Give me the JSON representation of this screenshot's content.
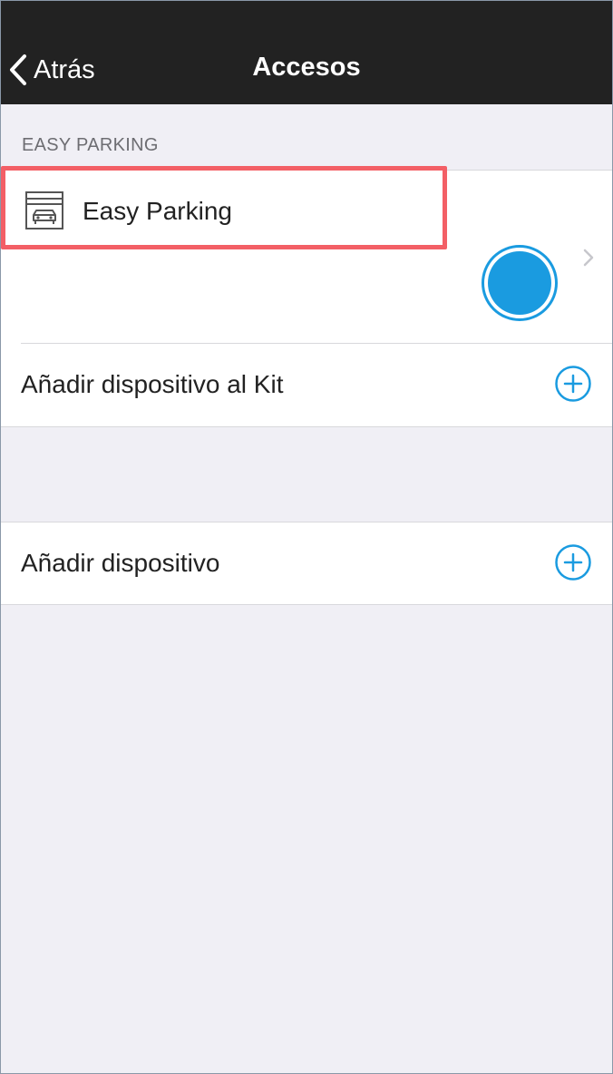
{
  "nav": {
    "back_label": "Atrás",
    "title": "Accesos"
  },
  "section_header": "EASY PARKING",
  "device": {
    "name": "Easy Parking",
    "icon": "garage-car-icon",
    "status_color": "#1a9be0"
  },
  "actions": {
    "add_to_kit": "Añadir dispositivo al Kit",
    "add_device": "Añadir dispositivo"
  },
  "colors": {
    "nav_background": "#222222",
    "accent": "#1a9be0",
    "highlight": "#f35f66",
    "page_background": "#f0eff5"
  }
}
